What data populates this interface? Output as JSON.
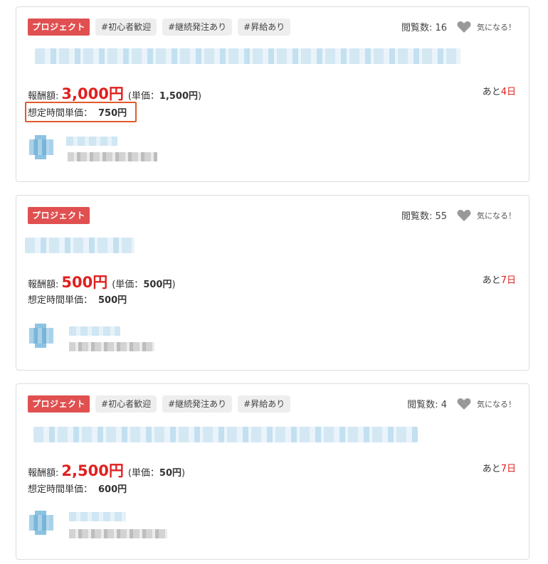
{
  "cards": [
    {
      "type_label": "プロジェクト",
      "tags": [
        "#初心者歓迎",
        "#継続発注あり",
        "#昇給あり"
      ],
      "views_label": "閲覧数: 16",
      "favorite_label": "気になる！",
      "reward_label": "報酬額:",
      "reward_amount": "3,000円",
      "unit_price_prefix": "(単価：",
      "unit_price_value": "1,500円",
      "unit_price_suffix": ")",
      "hourly_label": "想定時間単価：",
      "hourly_value": "750円",
      "deadline_prefix": "あと",
      "deadline_days": "4日",
      "hourly_highlighted": true
    },
    {
      "type_label": "プロジェクト",
      "tags": [],
      "views_label": "閲覧数: 55",
      "favorite_label": "気になる！",
      "reward_label": "報酬額:",
      "reward_amount": "500円",
      "unit_price_prefix": "(単価：",
      "unit_price_value": "500円",
      "unit_price_suffix": ")",
      "hourly_label": "想定時間単価：",
      "hourly_value": "500円",
      "deadline_prefix": "あと",
      "deadline_days": "7日",
      "hourly_highlighted": false
    },
    {
      "type_label": "プロジェクト",
      "tags": [
        "#初心者歓迎",
        "#継続発注あり",
        "#昇給あり"
      ],
      "views_label": "閲覧数: 4",
      "favorite_label": "気になる！",
      "reward_label": "報酬額:",
      "reward_amount": "2,500円",
      "unit_price_prefix": "(単価：",
      "unit_price_value": "50円",
      "unit_price_suffix": ")",
      "hourly_label": "想定時間単価：",
      "hourly_value": "600円",
      "deadline_prefix": "あと",
      "deadline_days": "7日",
      "hourly_highlighted": false
    }
  ],
  "colors": {
    "badge": "#e05050",
    "reward": "#e02020",
    "highlight_border": "#e05a2a",
    "heart": "#999999"
  },
  "icons": {
    "favorite": "heart-icon"
  }
}
